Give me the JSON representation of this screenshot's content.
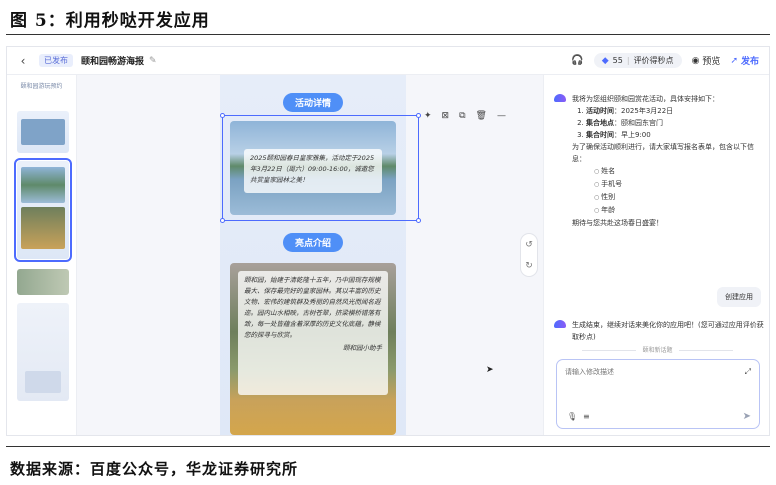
{
  "figure": {
    "title": "图 5：利用秒哒开发应用",
    "source": "数据来源：百度公众号，华龙证券研究所"
  },
  "topbar": {
    "back": "‹",
    "status": "已发布",
    "doc_title": "颐和园畅游海报",
    "edit_icon": "✎",
    "headset_icon": "🎧",
    "credits": "55",
    "credits_action": "评价得秒点",
    "preview": "预览",
    "publish": "发布"
  },
  "thumbs": {
    "header": "颐和园游玩预约"
  },
  "poster": {
    "section1": "活动详情",
    "card1": "2025颐和园春日皇家雅集，活动定于2025年3月22日（周六）09:00-16:00，诚邀您共赏皇家园林之美！",
    "section2": "亮点介绍",
    "card2": "颐和园，始建于清乾隆十五年，乃中国现存规模最大、保存最完好的皇家园林。其以丰富的历史文物、宏伟的建筑群及秀丽的自然风光而闻名遐迩。园内山水相映，古树苍翠，挤梁横桥错落有致，每一处皆蕴含着深厚的历史文化底蕴，静候您的探寻与欣赏。",
    "card2_sign": "颐和园小助手"
  },
  "toolbar": {
    "items": [
      "✦",
      "⊠",
      "⧉",
      "🗑",
      "—"
    ]
  },
  "history": {
    "undo": "↺",
    "redo": "↻"
  },
  "chat": {
    "msg1_intro": "我将为您组织颐和园赏花活动，具体安排如下：",
    "msg1_items": [
      {
        "label": "活动时间",
        "value": "2025年3月22日"
      },
      {
        "label": "集合地点",
        "value": "颐和园东宫门"
      },
      {
        "label": "集合时间",
        "value": "早上9:00"
      }
    ],
    "msg1_form_intro": "为了确保活动顺利进行，请大家填写报名表单，包含以下信息：",
    "msg1_fields": [
      "姓名",
      "手机号",
      "性别",
      "年龄"
    ],
    "msg1_outro": "期待与您共赴这场春日盛宴！",
    "user_msg": "创建应用",
    "msg2": "生成结束，继续对话来美化你的应用吧！(您可通过应用评价获取秒点)",
    "divider": "颐和新话题",
    "input_placeholder": "请输入修改描述"
  }
}
